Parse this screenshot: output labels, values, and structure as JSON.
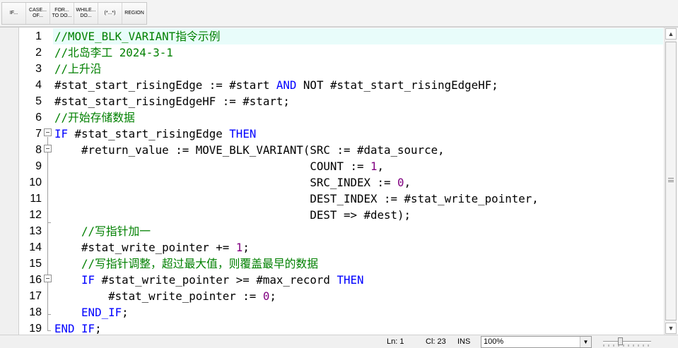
{
  "toolbar": {
    "buttons": [
      {
        "label": "IF..."
      },
      {
        "label": "CASE...\nOF..."
      },
      {
        "label": "FOR...\nTO DO..."
      },
      {
        "label": "WHILE...\nDO..."
      },
      {
        "label": "(*...*)"
      },
      {
        "label": "REGION"
      }
    ]
  },
  "editor": {
    "active_line": 1,
    "lines": [
      {
        "no": "1",
        "tokens": [
          {
            "t": "//MOVE_BLK_VARIANT指令示例",
            "c": "comment"
          }
        ]
      },
      {
        "no": "2",
        "tokens": [
          {
            "t": "//北岛李工 2024-3-1",
            "c": "comment"
          }
        ]
      },
      {
        "no": "3",
        "tokens": [
          {
            "t": "//上升沿",
            "c": "comment"
          }
        ]
      },
      {
        "no": "4",
        "tokens": [
          {
            "t": "#stat_start_risingEdge := #start ",
            "c": "var"
          },
          {
            "t": "AND",
            "c": "kw"
          },
          {
            "t": " NOT #stat_start_risingEdgeHF;",
            "c": "var"
          }
        ]
      },
      {
        "no": "5",
        "tokens": [
          {
            "t": "#stat_start_risingEdgeHF := #start;",
            "c": "var"
          }
        ]
      },
      {
        "no": "6",
        "tokens": [
          {
            "t": "//开始存储数据",
            "c": "comment"
          }
        ]
      },
      {
        "no": "7",
        "tokens": [
          {
            "t": "IF",
            "c": "kw"
          },
          {
            "t": " #stat_start_risingEdge ",
            "c": "var"
          },
          {
            "t": "THEN",
            "c": "kw"
          }
        ]
      },
      {
        "no": "8",
        "tokens": [
          {
            "t": "    #return_value := MOVE_BLK_VARIANT(SRC := #data_source,",
            "c": "var"
          }
        ]
      },
      {
        "no": "9",
        "tokens": [
          {
            "t": "                                      COUNT := ",
            "c": "var"
          },
          {
            "t": "1",
            "c": "num"
          },
          {
            "t": ",",
            "c": "var"
          }
        ]
      },
      {
        "no": "10",
        "tokens": [
          {
            "t": "                                      SRC_INDEX := ",
            "c": "var"
          },
          {
            "t": "0",
            "c": "num"
          },
          {
            "t": ",",
            "c": "var"
          }
        ]
      },
      {
        "no": "11",
        "tokens": [
          {
            "t": "                                      DEST_INDEX := #stat_write_pointer,",
            "c": "var"
          }
        ]
      },
      {
        "no": "12",
        "tokens": [
          {
            "t": "                                      DEST => #dest);",
            "c": "var"
          }
        ]
      },
      {
        "no": "13",
        "tokens": [
          {
            "t": "    //写指针加一",
            "c": "comment"
          }
        ]
      },
      {
        "no": "14",
        "tokens": [
          {
            "t": "    #stat_write_pointer += ",
            "c": "var"
          },
          {
            "t": "1",
            "c": "num"
          },
          {
            "t": ";",
            "c": "var"
          }
        ]
      },
      {
        "no": "15",
        "tokens": [
          {
            "t": "    //写指针调整，超过最大值，则覆盖最早的数据",
            "c": "comment"
          }
        ]
      },
      {
        "no": "16",
        "tokens": [
          {
            "t": "    ",
            "c": "var"
          },
          {
            "t": "IF",
            "c": "kw"
          },
          {
            "t": " #stat_write_pointer >= #max_record ",
            "c": "var"
          },
          {
            "t": "THEN",
            "c": "kw"
          }
        ]
      },
      {
        "no": "17",
        "tokens": [
          {
            "t": "        #stat_write_pointer := ",
            "c": "var"
          },
          {
            "t": "0",
            "c": "num"
          },
          {
            "t": ";",
            "c": "var"
          }
        ]
      },
      {
        "no": "18",
        "tokens": [
          {
            "t": "    ",
            "c": "var"
          },
          {
            "t": "END_IF",
            "c": "kw"
          },
          {
            "t": ";",
            "c": "var"
          }
        ]
      },
      {
        "no": "19",
        "tokens": [
          {
            "t": "END_IF",
            "c": "kw"
          },
          {
            "t": ";",
            "c": "var"
          }
        ]
      }
    ]
  },
  "statusbar": {
    "ln": "Ln: 1",
    "col": "Cl: 23",
    "mode": "INS",
    "zoom": "100%"
  },
  "colors": {
    "comment": "#008000",
    "keyword": "#0000ff",
    "number": "#800080",
    "active_line_bg": "#e8fcfa"
  }
}
